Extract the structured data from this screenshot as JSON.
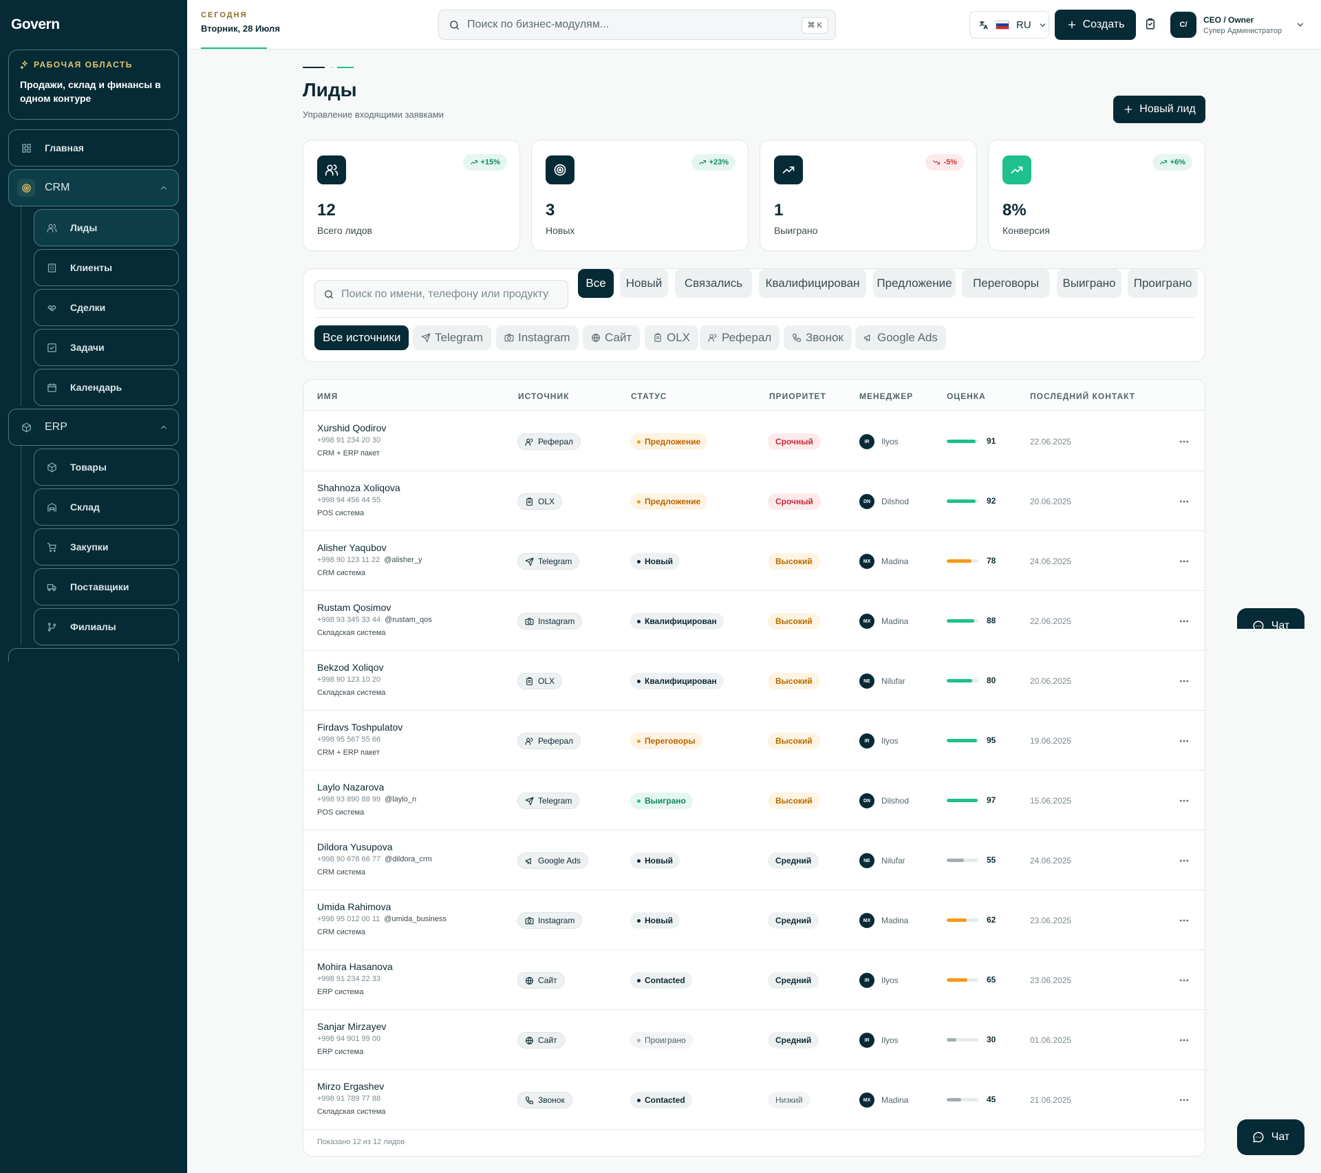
{
  "sidebar": {
    "logo": "Govern",
    "workspace": {
      "label": "РАБОЧАЯ ОБЛАСТЬ",
      "text": "Продажи, склад и финансы в одном контуре"
    },
    "home": "Главная",
    "crm": {
      "label": "CRM",
      "items": [
        "Лиды",
        "Клиенты",
        "Сделки",
        "Задачи",
        "Календарь"
      ]
    },
    "erp": {
      "label": "ERP",
      "items": [
        "Товары",
        "Склад",
        "Закупки",
        "Поставщики",
        "Филиалы"
      ]
    }
  },
  "header": {
    "today_label": "СЕГОДНЯ",
    "today_date": "Вторник, 28 Июля",
    "search_placeholder": "Поиск по бизнес-модулям...",
    "search_shortcut": "⌘ K",
    "lang": "RU",
    "create": "Создать",
    "user_initials": "C/",
    "user_name": "CEO / Owner",
    "user_role": "Супер Администратор"
  },
  "page": {
    "title": "Лиды",
    "subtitle": "Управление входящими заявками",
    "new_lead": "Новый лид"
  },
  "stats": [
    {
      "value": "12",
      "label": "Всего лидов",
      "delta": "+15%"
    },
    {
      "value": "3",
      "label": "Новых",
      "delta": "+23%"
    },
    {
      "value": "1",
      "label": "Выиграно",
      "delta": "-5%"
    },
    {
      "value": "8%",
      "label": "Конверсия",
      "delta": "+6%"
    }
  ],
  "filters": {
    "search_placeholder": "Поиск по имени, телефону или продукту",
    "statuses": [
      "Все",
      "Новый",
      "Связались",
      "Квалифицирован",
      "Предложение",
      "Переговоры",
      "Выиграно",
      "Проиграно"
    ],
    "sources": [
      "Все источники",
      "Telegram",
      "Instagram",
      "Сайт",
      "OLX",
      "Реферал",
      "Звонок",
      "Google Ads"
    ]
  },
  "table": {
    "columns": [
      "ИМЯ",
      "ИСТОЧНИК",
      "СТАТУС",
      "ПРИОРИТЕТ",
      "МЕНЕДЖЕР",
      "ОЦЕНКА",
      "ПОСЛЕДНИЙ КОНТАКТ"
    ],
    "rows": [
      {
        "name": "Xurshid Qodirov",
        "phone": "+998 91 234 20 30",
        "tg": "",
        "product": "CRM + ERP пакет",
        "source": "Реферал",
        "status": "Предложение",
        "priority": "Срочный",
        "mgr_initials": "IR",
        "manager": "Ilyos",
        "score": "91",
        "last": "22.06.2025"
      },
      {
        "name": "Shahnoza Xoliqova",
        "phone": "+998 94 456 44 55",
        "tg": "",
        "product": "POS система",
        "source": "OLX",
        "status": "Предложение",
        "priority": "Срочный",
        "mgr_initials": "DN",
        "manager": "Dilshod",
        "score": "92",
        "last": "20.06.2025"
      },
      {
        "name": "Alisher Yaqubov",
        "phone": "+998 90 123 11 22",
        "tg": "@alisher_y",
        "product": "CRM система",
        "source": "Telegram",
        "status": "Новый",
        "priority": "Высокий",
        "mgr_initials": "MX",
        "manager": "Madina",
        "score": "78",
        "last": "24.06.2025"
      },
      {
        "name": "Rustam Qosimov",
        "phone": "+998 93 345 33 44",
        "tg": "@rustam_qos",
        "product": "Складская система",
        "source": "Instagram",
        "status": "Квалифицирован",
        "priority": "Высокий",
        "mgr_initials": "MX",
        "manager": "Madina",
        "score": "88",
        "last": "22.06.2025"
      },
      {
        "name": "Bekzod Xoliqov",
        "phone": "+998 90 123 10 20",
        "tg": "",
        "product": "Складская система",
        "source": "OLX",
        "status": "Квалифицирован",
        "priority": "Высокий",
        "mgr_initials": "NE",
        "manager": "Nilufar",
        "score": "80",
        "last": "20.06.2025"
      },
      {
        "name": "Firdavs Toshpulatov",
        "phone": "+998 95 567 55 66",
        "tg": "",
        "product": "CRM + ERP пакет",
        "source": "Реферал",
        "status": "Переговоры",
        "priority": "Высокий",
        "mgr_initials": "IR",
        "manager": "Ilyos",
        "score": "95",
        "last": "19.06.2025"
      },
      {
        "name": "Laylo Nazarova",
        "phone": "+998 93 890 88 99",
        "tg": "@laylo_n",
        "product": "POS система",
        "source": "Telegram",
        "status": "Выиграно",
        "priority": "Высокий",
        "mgr_initials": "DN",
        "manager": "Dilshod",
        "score": "97",
        "last": "15.06.2025"
      },
      {
        "name": "Dildora Yusupova",
        "phone": "+998 90 678 66 77",
        "tg": "@dildora_crm",
        "product": "CRM система",
        "source": "Google Ads",
        "status": "Новый",
        "priority": "Средний",
        "mgr_initials": "NE",
        "manager": "Nilufar",
        "score": "55",
        "last": "24.06.2025"
      },
      {
        "name": "Umida Rahimova",
        "phone": "+998 95 012 00 11",
        "tg": "@umida_business",
        "product": "CRM система",
        "source": "Instagram",
        "status": "Новый",
        "priority": "Средний",
        "mgr_initials": "MX",
        "manager": "Madina",
        "score": "62",
        "last": "23.06.2025"
      },
      {
        "name": "Mohira Hasanova",
        "phone": "+998 91 234 22 33",
        "tg": "",
        "product": "ERP система",
        "source": "Сайт",
        "status": "Contacted",
        "priority": "Средний",
        "mgr_initials": "IR",
        "manager": "Ilyos",
        "score": "65",
        "last": "23.06.2025"
      },
      {
        "name": "Sanjar Mirzayev",
        "phone": "+998 94 901 99 00",
        "tg": "",
        "product": "ERP система",
        "source": "Сайт",
        "status": "Проиграно",
        "priority": "Средний",
        "mgr_initials": "IR",
        "manager": "Ilyos",
        "score": "30",
        "last": "01.06.2025"
      },
      {
        "name": "Mirzo Ergashev",
        "phone": "+998 91 789 77 88",
        "tg": "",
        "product": "Складская система",
        "source": "Звонок",
        "status": "Contacted",
        "priority": "Низкий",
        "mgr_initials": "MX",
        "manager": "Madina",
        "score": "45",
        "last": "21.06.2025"
      }
    ],
    "footer": "Показано 12 из 12 лидов"
  },
  "chat": "Чат",
  "colors": {
    "primary": "#062a36",
    "accent": "#1ec08d",
    "warn": "#f49a17",
    "danger": "#d0343a"
  }
}
